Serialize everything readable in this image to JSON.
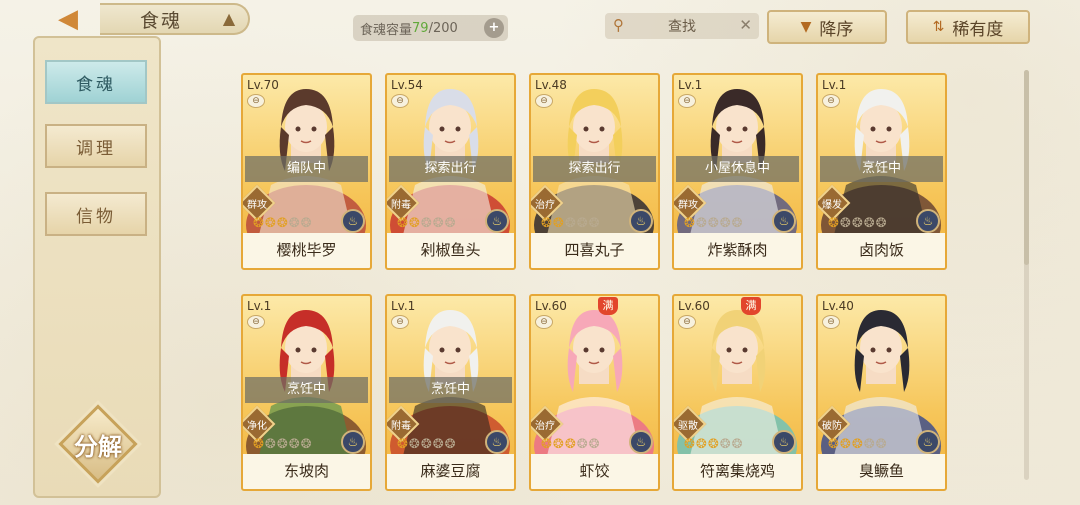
{
  "header": {
    "title": "食魂",
    "capacity_label": "食魂容量",
    "capacity_current": "79",
    "capacity_max": "/200",
    "search_label": "查找",
    "sort_order_label": "降序",
    "sort_by_label": "稀有度"
  },
  "sidebar": {
    "tabs": [
      {
        "label": "食魂",
        "active": true
      },
      {
        "label": "调理",
        "active": false
      },
      {
        "label": "信物",
        "active": false
      }
    ],
    "decompose_label": "分解"
  },
  "cards": [
    {
      "level": "Lv.70",
      "status": "编队中",
      "role": "群攻",
      "stars": 3,
      "name": "樱桃毕罗",
      "max": false,
      "colors": [
        "#5b3a2c",
        "#b94b3c",
        "#f2e6d4"
      ]
    },
    {
      "level": "Lv.54",
      "status": "探索出行",
      "role": "附毒",
      "stars": 2,
      "name": "剁椒鱼头",
      "max": false,
      "colors": [
        "#d9dde8",
        "#c83a30",
        "#f4f1ea"
      ]
    },
    {
      "level": "Lv.48",
      "status": "探索出行",
      "role": "治疗",
      "stars": 2,
      "name": "四喜丸子",
      "max": false,
      "colors": [
        "#f3cf5c",
        "#2f2b33",
        "#f7e2b4"
      ]
    },
    {
      "level": "Lv.1",
      "status": "小屋休息中",
      "role": "群攻",
      "stars": 1,
      "name": "炸紫酥肉",
      "max": false,
      "colors": [
        "#3a2a28",
        "#5a5c86",
        "#eeeef0"
      ]
    },
    {
      "level": "Lv.1",
      "status": "烹饪中",
      "role": "爆发",
      "stars": 1,
      "name": "卤肉饭",
      "max": false,
      "colors": [
        "#f1f1ee",
        "#6a4432",
        "#2b2b2b"
      ]
    },
    {
      "level": "Lv.1",
      "status": "烹饪中",
      "role": "净化",
      "stars": 1,
      "name": "东坡肉",
      "max": false,
      "colors": [
        "#c62e28",
        "#7a4a2a",
        "#3f8a4a"
      ]
    },
    {
      "level": "Lv.1",
      "status": "烹饪中",
      "role": "附毒",
      "stars": 1,
      "name": "麻婆豆腐",
      "max": false,
      "colors": [
        "#f1f1ee",
        "#c84a2a",
        "#2b2420"
      ]
    },
    {
      "level": "Lv.60",
      "status": "",
      "role": "治疗",
      "stars": 3,
      "name": "虾饺",
      "max": true,
      "colors": [
        "#f7a8b8",
        "#ea6f8c",
        "#fff4f6"
      ]
    },
    {
      "level": "Lv.60",
      "status": "",
      "role": "驱散",
      "stars": 3,
      "name": "符离集烧鸡",
      "max": true,
      "colors": [
        "#f1d277",
        "#6ec2b8",
        "#f6f2e8"
      ]
    },
    {
      "level": "Lv.40",
      "status": "",
      "role": "破防",
      "stars": 3,
      "name": "臭鳜鱼",
      "max": false,
      "colors": [
        "#2a2a33",
        "#3e4f8c",
        "#efefef"
      ]
    }
  ],
  "max_badge": "满",
  "accent_color": "#e6a838"
}
